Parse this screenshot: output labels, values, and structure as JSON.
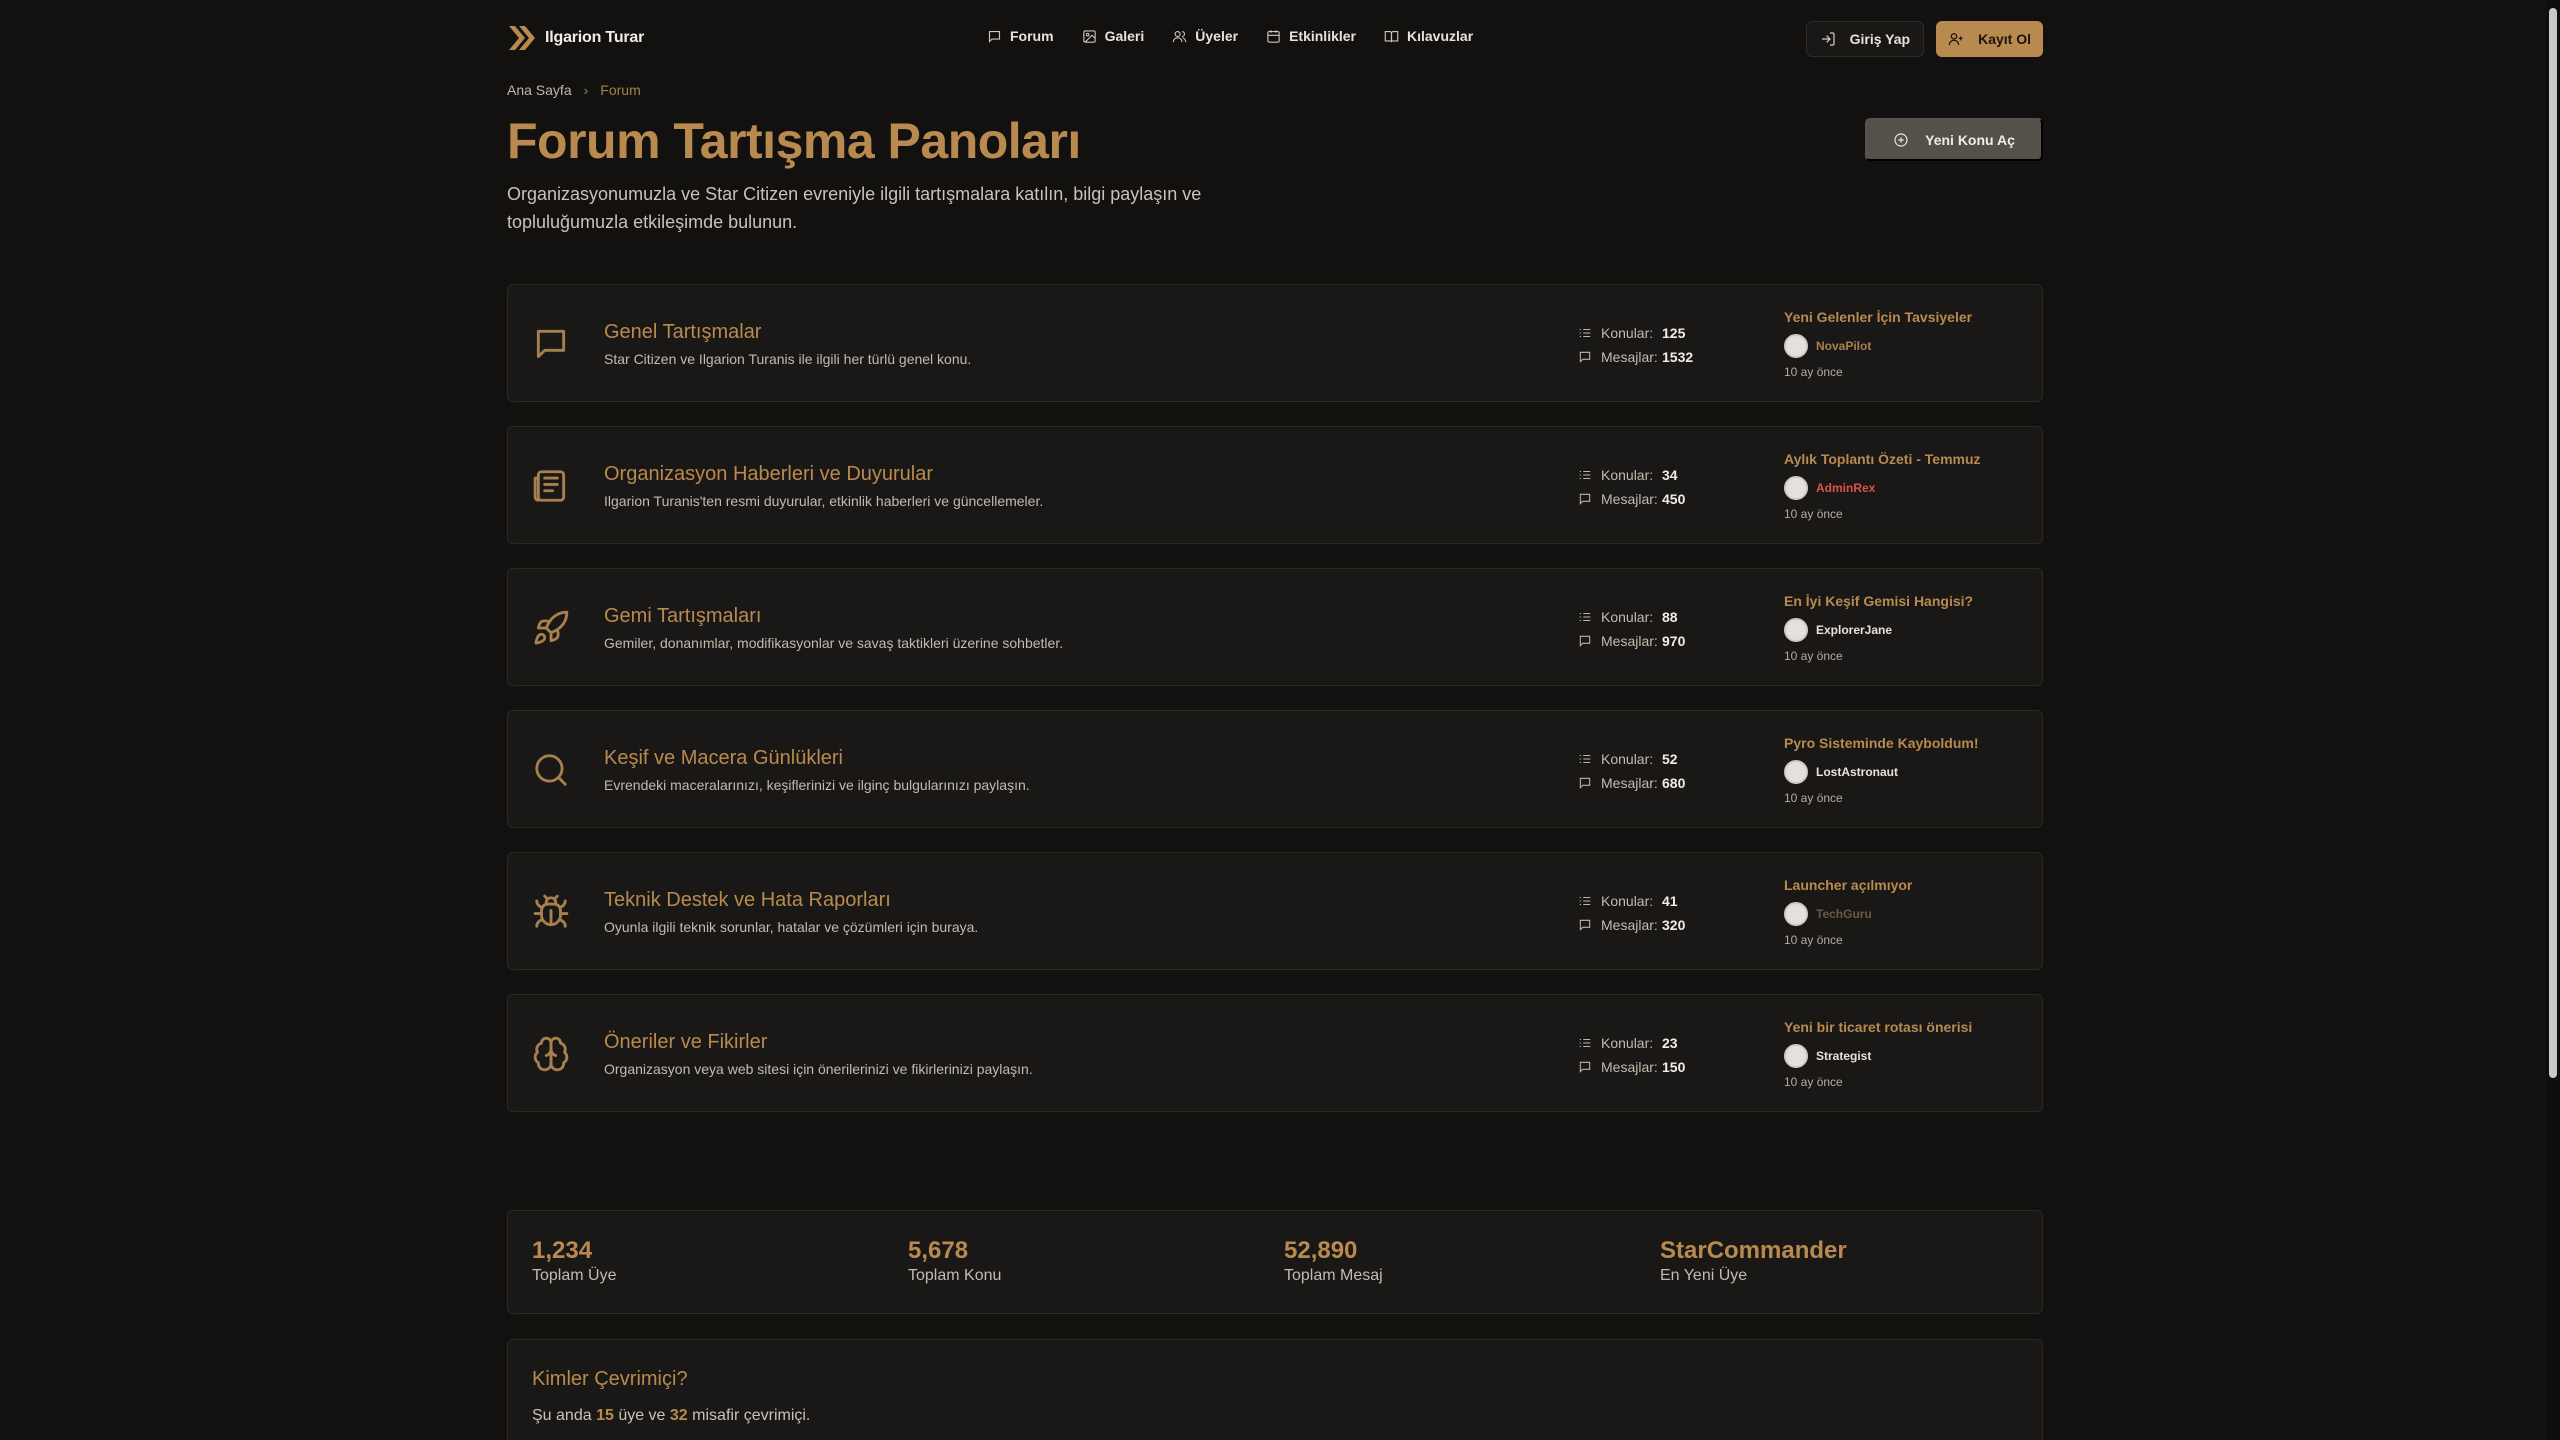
{
  "brand": {
    "name": "Ilgarion Turar",
    "icon": "double-chevron-icon"
  },
  "nav": [
    {
      "label": "Forum",
      "icon": "chat-icon"
    },
    {
      "label": "Galeri",
      "icon": "image-icon"
    },
    {
      "label": "Üyeler",
      "icon": "users-icon"
    },
    {
      "label": "Etkinlikler",
      "icon": "calendar-icon"
    },
    {
      "label": "Kılavuzlar",
      "icon": "book-icon"
    }
  ],
  "auth": {
    "login": "Giriş Yap",
    "register": "Kayıt Ol"
  },
  "breadcrumb": {
    "home": "Ana Sayfa",
    "current": "Forum"
  },
  "page": {
    "title": "Forum Tartışma Panoları",
    "description": "Organizasyonumuzla ve Star Citizen evreniyle ilgili tartışmalara katılın, bilgi paylaşın ve topluluğumuzla etkileşimde bulunun.",
    "new_topic": "Yeni Konu Aç"
  },
  "labels": {
    "topics": "Konular:",
    "messages": "Mesajlar:"
  },
  "forums": [
    {
      "title": "Genel Tartışmalar",
      "description": "Star Citizen ve Ilgarion Turanis ile ilgili her türlü genel konu.",
      "icon": "chat-bubble-icon",
      "topics": "125",
      "messages": "1532",
      "last_title": "Yeni Gelenler İçin Tavsiyeler",
      "last_user": "NovaPilot",
      "last_user_color": "#a6814f",
      "last_time": "10 ay önce"
    },
    {
      "title": "Organizasyon Haberleri ve Duyurular",
      "description": "Ilgarion Turanis'ten resmi duyurular, etkinlik haberleri ve güncellemeler.",
      "icon": "newspaper-icon",
      "topics": "34",
      "messages": "450",
      "last_title": "Aylık Toplantı Özeti - Temmuz",
      "last_user": "AdminRex",
      "last_user_color": "#d9534f",
      "last_time": "10 ay önce"
    },
    {
      "title": "Gemi Tartışmaları",
      "description": "Gemiler, donanımlar, modifikasyonlar ve savaş taktikleri üzerine sohbetler.",
      "icon": "rocket-icon",
      "topics": "88",
      "messages": "970",
      "last_title": "En İyi Keşif Gemisi Hangisi?",
      "last_user": "ExplorerJane",
      "last_user_color": "#e8e2d8",
      "last_time": "10 ay önce"
    },
    {
      "title": "Keşif ve Macera Günlükleri",
      "description": "Evrendeki maceralarınızı, keşiflerinizi ve ilginç bulgularınızı paylaşın.",
      "icon": "search-icon",
      "topics": "52",
      "messages": "680",
      "last_title": "Pyro Sisteminde Kayboldum!",
      "last_user": "LostAstronaut",
      "last_user_color": "#e8e2d8",
      "last_time": "10 ay önce"
    },
    {
      "title": "Teknik Destek ve Hata Raporları",
      "description": "Oyunla ilgili teknik sorunlar, hatalar ve çözümleri için buraya.",
      "icon": "bug-icon",
      "topics": "41",
      "messages": "320",
      "last_title": "Launcher açılmıyor",
      "last_user": "TechGuru",
      "last_user_color": "#6d5a40",
      "last_time": "10 ay önce"
    },
    {
      "title": "Öneriler ve Fikirler",
      "description": "Organizasyon veya web sitesi için önerilerinizi ve fikirlerinizi paylaşın.",
      "icon": "brain-icon",
      "topics": "23",
      "messages": "150",
      "last_title": "Yeni bir ticaret rotası önerisi",
      "last_user": "Strategist",
      "last_user_color": "#e8e2d8",
      "last_time": "10 ay önce"
    }
  ],
  "summary": [
    {
      "value": "1,234",
      "label": "Toplam Üye"
    },
    {
      "value": "5,678",
      "label": "Toplam Konu"
    },
    {
      "value": "52,890",
      "label": "Toplam Mesaj"
    },
    {
      "value": "StarCommander",
      "label": "En Yeni Üye"
    }
  ],
  "online": {
    "title": "Kimler Çevrimiçi?",
    "prefix": "Şu anda",
    "members": "15",
    "middle": "üye ve",
    "guests": "32",
    "suffix": "misafir çevrimiçi."
  },
  "colors": {
    "accent": "#b88a4f",
    "background": "#121110",
    "card": "#1a1816"
  }
}
